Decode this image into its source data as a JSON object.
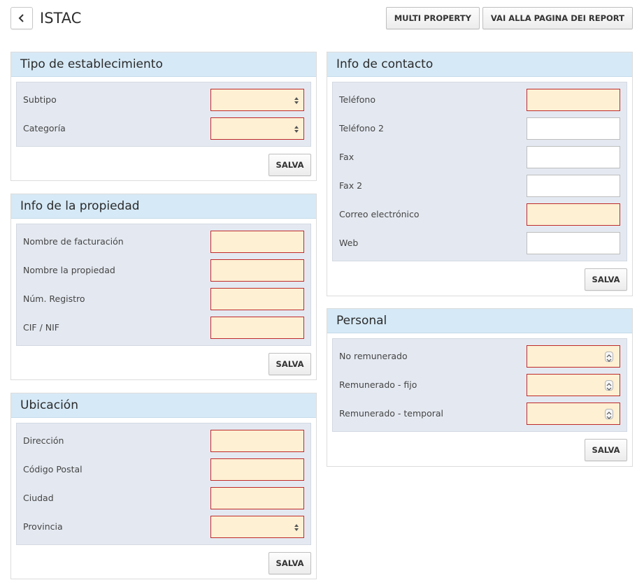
{
  "header": {
    "title": "ISTAC",
    "actions": [
      "MULTI PROPERTY",
      "VAI ALLA PAGINA DEI REPORT"
    ]
  },
  "save_label": "SALVA",
  "panels": {
    "tipo": {
      "title": "Tipo de establecimiento",
      "fields": [
        "Subtipo",
        "Categoría"
      ]
    },
    "propiedad": {
      "title": "Info de la propiedad",
      "fields": [
        "Nombre de facturación",
        "Nombre la propiedad",
        "Núm. Registro",
        "CIF / NIF"
      ]
    },
    "ubicacion": {
      "title": "Ubicación",
      "fields": [
        "Dirección",
        "Código Postal",
        "Ciudad",
        "Provincia"
      ]
    },
    "contacto": {
      "title": "Info de contacto",
      "fields": [
        "Teléfono",
        "Teléfono 2",
        "Fax",
        "Fax 2",
        "Correo electrónico",
        "Web"
      ]
    },
    "personal": {
      "title": "Personal",
      "fields": [
        "No remunerado",
        "Remunerado - fijo",
        "Remunerado - temporal"
      ]
    }
  },
  "colors": {
    "panel_header": "#d6e9f6",
    "panel_body": "#e4e9f1",
    "required_bg": "#fdf0d3",
    "required_border": "#c02a2a"
  }
}
